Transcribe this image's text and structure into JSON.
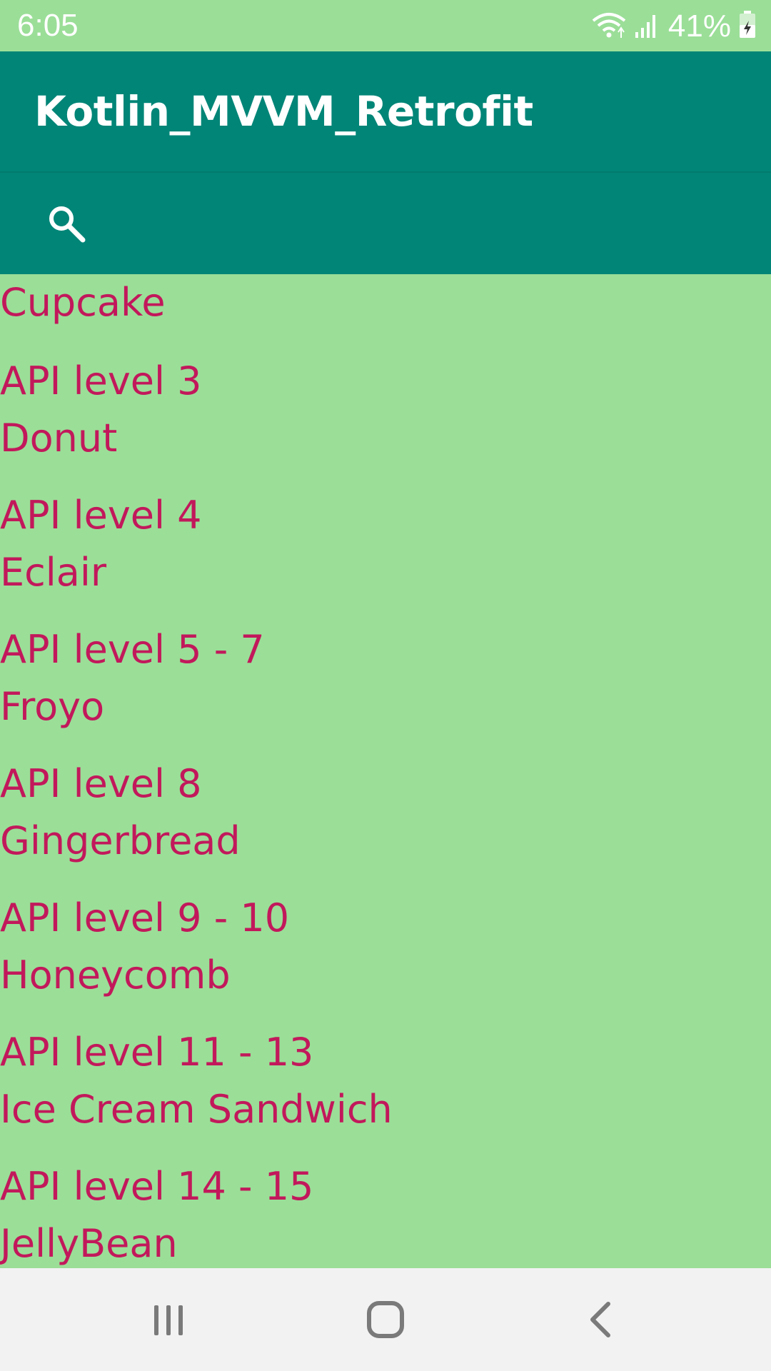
{
  "status_bar": {
    "time": "6:05",
    "battery": "41%"
  },
  "app_bar": {
    "title": "Kotlin_MVVM_Retrofit"
  },
  "list_items": [
    {
      "name": "Cupcake"
    },
    {
      "api": "API level 3",
      "name": "Donut"
    },
    {
      "api": "API level 4",
      "name": "Eclair"
    },
    {
      "api": "API level 5 - 7",
      "name": "Froyo"
    },
    {
      "api": "API level 8",
      "name": "Gingerbread"
    },
    {
      "api": "API level 9 - 10",
      "name": "Honeycomb"
    },
    {
      "api": "API level 11 - 13",
      "name": "Ice Cream Sandwich"
    },
    {
      "api": "API level 14 - 15",
      "name": "JellyBean"
    }
  ],
  "colors": {
    "background": "#9BDE98",
    "app_bar": "#008577",
    "item_text": "#C2185B",
    "nav_bar": "#F2F2F2"
  },
  "icons": {
    "search": "search-icon",
    "wifi": "wifi-icon",
    "signal": "signal-icon",
    "battery": "battery-charging-icon",
    "recents": "recents-icon",
    "home": "home-icon",
    "back": "back-icon"
  }
}
